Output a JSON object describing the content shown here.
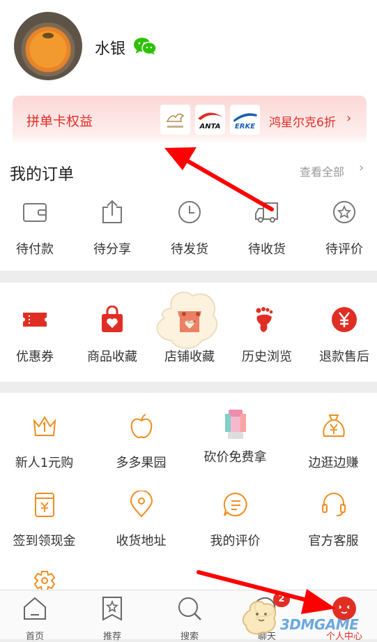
{
  "profile": {
    "username": "水银"
  },
  "pin_card": {
    "title": "拼单卡权益",
    "brands": [
      "ANTA",
      "ERKE"
    ],
    "discount": "鸿星尔克6折",
    "chevron": "›"
  },
  "orders": {
    "title": "我的订单",
    "view_all": "查看全部",
    "chevron": "›",
    "items": [
      {
        "label": "待付款",
        "icon": "wallet-icon"
      },
      {
        "label": "待分享",
        "icon": "share-icon"
      },
      {
        "label": "待发货",
        "icon": "clock-icon"
      },
      {
        "label": "待收货",
        "icon": "truck-icon"
      },
      {
        "label": "待评价",
        "icon": "review-star-icon"
      }
    ]
  },
  "favorites": {
    "items": [
      {
        "label": "优惠券",
        "icon": "coupon-icon"
      },
      {
        "label": "商品收藏",
        "icon": "bag-heart-icon"
      },
      {
        "label": "店铺收藏",
        "icon": "store-heart-icon"
      },
      {
        "label": "历史浏览",
        "icon": "footprint-icon"
      },
      {
        "label": "退款售后",
        "icon": "yen-icon"
      }
    ]
  },
  "tools": {
    "items": [
      {
        "label": "新人1元购",
        "icon": "crown-icon"
      },
      {
        "label": "多多果园",
        "icon": "apple-icon"
      },
      {
        "label": "砍价免费拿",
        "icon": "juicer-icon"
      },
      {
        "label": "边逛边赚",
        "icon": "money-bag-icon"
      },
      {
        "label": "签到领现金",
        "icon": "yen-calendar-icon"
      },
      {
        "label": "收货地址",
        "icon": "location-pin-icon"
      },
      {
        "label": "我的评价",
        "icon": "comment-icon"
      },
      {
        "label": "官方客服",
        "icon": "headset-icon"
      },
      {
        "label": "",
        "icon": "settings-gear-icon"
      }
    ]
  },
  "tabbar": {
    "tabs": [
      {
        "label": "首页",
        "icon": "home-icon"
      },
      {
        "label": "推荐",
        "icon": "recommend-icon"
      },
      {
        "label": "搜索",
        "icon": "search-icon"
      },
      {
        "label": "聊天",
        "icon": "chat-icon"
      },
      {
        "label": "个人中心",
        "icon": "profile-icon"
      }
    ],
    "chat_badge": "2"
  },
  "watermark": "3DMGAME",
  "colors": {
    "accent": "#e02e24",
    "orange": "#f08c1e",
    "annotation": "#ff0000"
  }
}
